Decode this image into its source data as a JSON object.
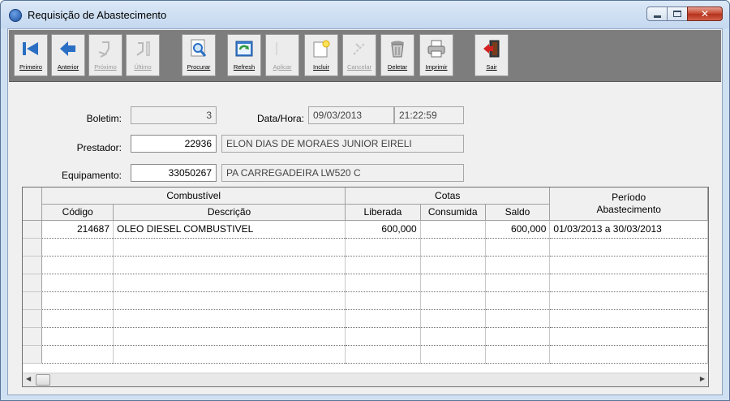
{
  "window": {
    "title": "Requisição de Abastecimento"
  },
  "toolbar": {
    "buttons": [
      {
        "label": "Primeiro",
        "icon": "first-record-icon",
        "enabled": true
      },
      {
        "label": "Anterior",
        "icon": "previous-arrow-icon",
        "enabled": true
      },
      {
        "label": "Próximo",
        "icon": "next-record-icon",
        "enabled": false
      },
      {
        "label": "Último",
        "icon": "last-record-icon",
        "enabled": false
      },
      {
        "label": "Procurar",
        "icon": "search-icon",
        "enabled": true
      },
      {
        "label": "Refresh",
        "icon": "refresh-icon",
        "enabled": true
      },
      {
        "label": "Aplicar",
        "icon": "apply-icon",
        "enabled": false
      },
      {
        "label": "Incluir",
        "icon": "new-record-icon",
        "enabled": true
      },
      {
        "label": "Cancelar",
        "icon": "cancel-icon",
        "enabled": false
      },
      {
        "label": "Deletar",
        "icon": "trash-icon",
        "enabled": true
      },
      {
        "label": "Imprimir",
        "icon": "printer-icon",
        "enabled": true
      },
      {
        "label": "Sair",
        "icon": "exit-door-icon",
        "enabled": true
      }
    ]
  },
  "form": {
    "boletim_label": "Boletim:",
    "boletim_value": "3",
    "datahora_label": "Data/Hora:",
    "data_value": "09/03/2013",
    "hora_value": "21:22:59",
    "prestador_label": "Prestador:",
    "prestador_code": "22936",
    "prestador_name": "ELON DIAS DE MORAES JUNIOR EIRELI",
    "equipamento_label": "Equipamento:",
    "equipamento_code": "33050267",
    "equipamento_name": "PA CARREGADEIRA LW520 C"
  },
  "grid": {
    "group_headers": {
      "combustivel": "Combustível",
      "cotas": "Cotas",
      "periodo": "Período",
      "abastecimento": "Abastecimento"
    },
    "columns": {
      "codigo": "Código",
      "descricao": "Descrição",
      "liberada": "Liberada",
      "consumida": "Consumida",
      "saldo": "Saldo"
    },
    "rows": [
      {
        "codigo": "214687",
        "descricao": "OLEO DIESEL COMBUSTIVEL",
        "liberada": "600,000",
        "consumida": "",
        "saldo": "600,000",
        "periodo": "01/03/2013 a 30/03/2013"
      }
    ],
    "empty_rows": 7
  },
  "colors": {
    "window_frame": "#cfe0f2",
    "toolbar_bg": "#7d7d7d",
    "client_bg": "#f0f0f0",
    "close_button": "#c3452e"
  }
}
